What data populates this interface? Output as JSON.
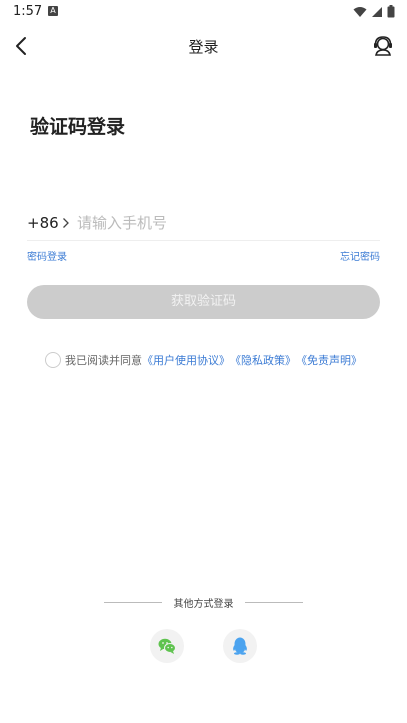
{
  "status_bar": {
    "time": "1:57",
    "notification_icon": "A"
  },
  "header": {
    "title": "登录",
    "back_icon": "chevron-left-icon",
    "service_icon": "customer-service-icon"
  },
  "main_title": "验证码登录",
  "phone": {
    "country_code": "+86",
    "placeholder": "请输入手机号",
    "value": ""
  },
  "links": {
    "password_login": "密码登录",
    "forgot_password": "忘记密码"
  },
  "submit_label": "获取验证码",
  "agreement": {
    "prefix": "我已阅读并同意",
    "user_agreement": "《用户使用协议》",
    "privacy_policy": "《隐私政策》",
    "disclaimer": "《免责声明》",
    "checked": false
  },
  "other_login": {
    "label": "其他方式登录",
    "wechat_icon": "wechat-icon",
    "qq_icon": "qq-icon"
  },
  "colors": {
    "link": "#3b7bd4",
    "button_disabled": "#cccccc",
    "wechat": "#5fc34f",
    "qq": "#4ba3ef"
  }
}
